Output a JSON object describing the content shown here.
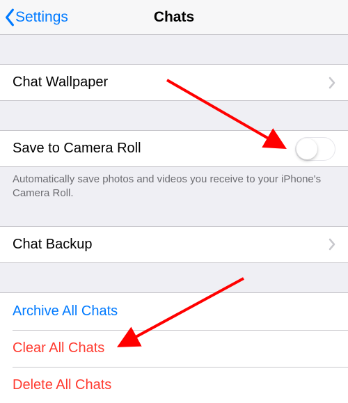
{
  "nav": {
    "back_label": "Settings",
    "title": "Chats"
  },
  "rows": {
    "wallpaper": "Chat Wallpaper",
    "save_camera_roll": "Save to Camera Roll",
    "save_camera_roll_footer": "Automatically save photos and videos you receive to your iPhone's Camera Roll.",
    "backup": "Chat Backup"
  },
  "actions": {
    "archive": "Archive All Chats",
    "clear": "Clear All Chats",
    "delete": "Delete All Chats"
  },
  "toggles": {
    "save_camera_roll_on": false
  },
  "colors": {
    "ios_blue": "#007aff",
    "ios_red": "#ff3b30",
    "separator": "#c8c7cc",
    "bg": "#efeff4",
    "footer_text": "#6d6d72",
    "arrow": "#ff0000"
  }
}
